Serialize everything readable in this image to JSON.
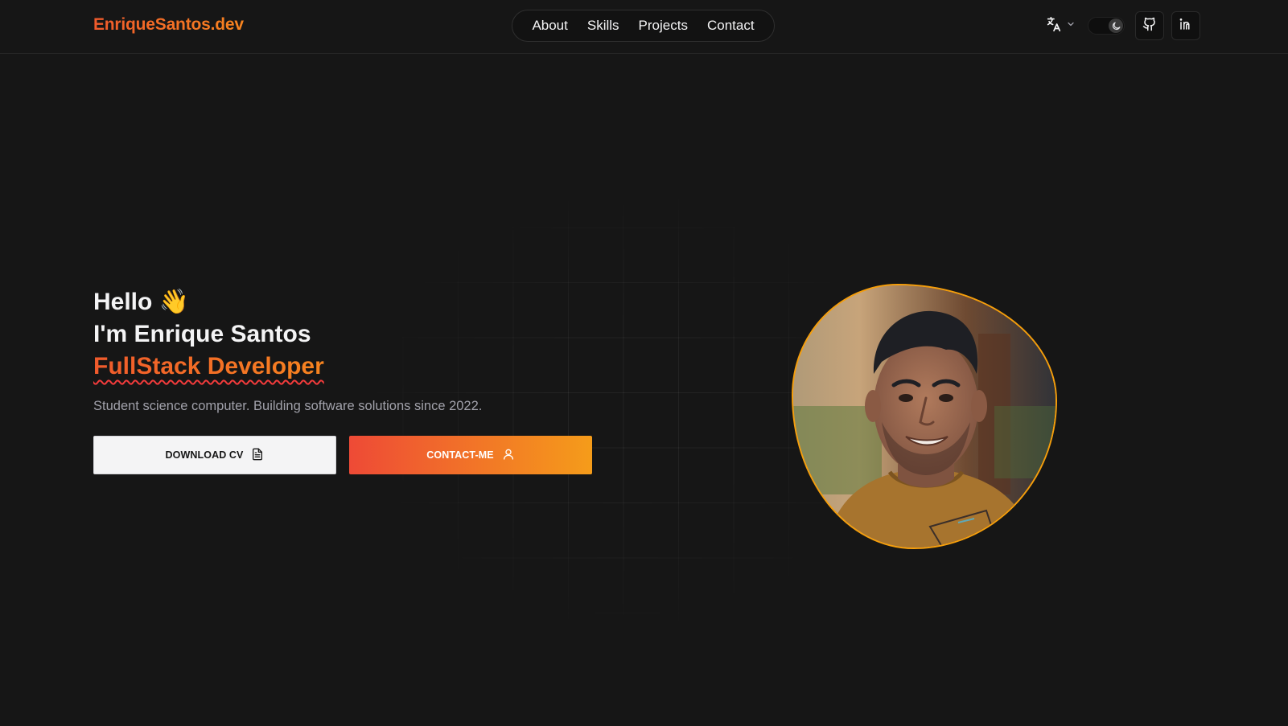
{
  "header": {
    "brand": "EnriqueSantos.dev",
    "nav": [
      "About",
      "Skills",
      "Projects",
      "Contact"
    ],
    "language_icon": "translate-icon",
    "theme_icon": "moon-icon",
    "social": [
      {
        "icon": "github-icon"
      },
      {
        "icon": "linkedin-icon"
      }
    ]
  },
  "hero": {
    "greeting": "Hello",
    "greeting_emoji": "👋",
    "intro": "I'm Enrique Santos",
    "role": "FullStack Developer",
    "subtitle": "Student science computer. Building software solutions since 2022.",
    "buttons": {
      "cv": "DOWNLOAD CV",
      "contact": "CONTACT-ME"
    },
    "portrait_alt": "Portrait photo"
  },
  "colors": {
    "background": "#161616",
    "accent_start": "#f05a2c",
    "accent_end": "#f7841f",
    "portrait_border": "#f59e0b",
    "muted_text": "#a1a1aa"
  }
}
